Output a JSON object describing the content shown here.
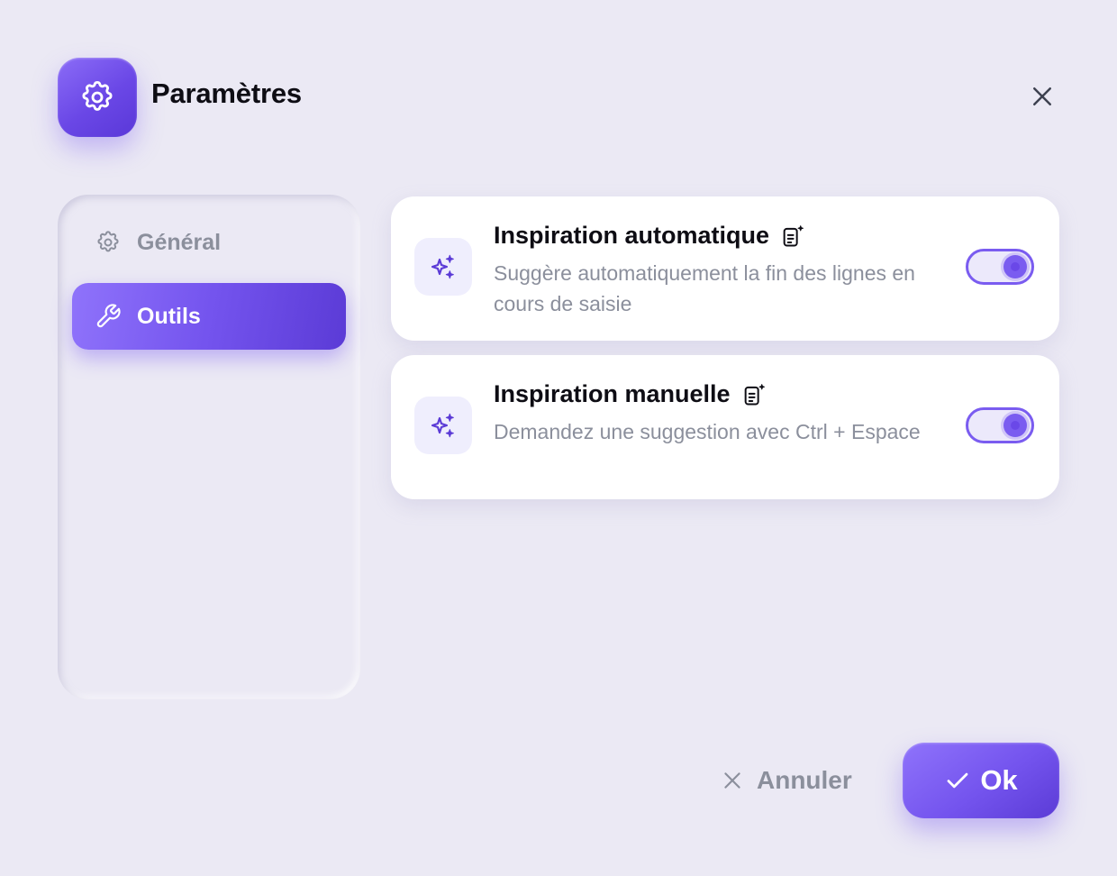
{
  "header": {
    "title": "Paramètres",
    "icon": "gear-icon",
    "close_icon": "close-icon"
  },
  "sidebar": {
    "items": [
      {
        "label": "Général",
        "icon": "gear-icon",
        "active": false
      },
      {
        "label": "Outils",
        "icon": "wrench-icon",
        "active": true
      }
    ]
  },
  "settings": [
    {
      "title": "Inspiration automatique",
      "description": "Suggère automatiquement la fin des lignes en cours de saisie",
      "icon": "sparkles-icon",
      "badge_icon": "ai-document-icon",
      "enabled": true
    },
    {
      "title": "Inspiration manuelle",
      "description": "Demandez une suggestion avec Ctrl + Espace",
      "icon": "sparkles-icon",
      "badge_icon": "ai-document-icon",
      "enabled": true
    }
  ],
  "footer": {
    "cancel_label": "Annuler",
    "ok_label": "Ok"
  },
  "colors": {
    "accent": "#7454ee",
    "background": "#ebe9f4",
    "muted_text": "#8b8f9c"
  }
}
